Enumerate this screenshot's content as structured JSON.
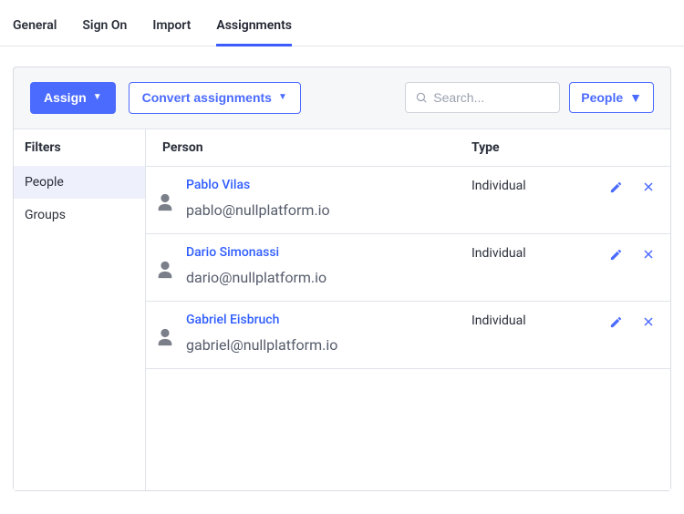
{
  "tabs": [
    {
      "label": "General",
      "active": false
    },
    {
      "label": "Sign On",
      "active": false
    },
    {
      "label": "Import",
      "active": false
    },
    {
      "label": "Assignments",
      "active": true
    }
  ],
  "toolbar": {
    "assign_label": "Assign",
    "convert_label": "Convert assignments",
    "search_placeholder": "Search...",
    "filter_button_label": "People"
  },
  "sidebar": {
    "title": "Filters",
    "items": [
      {
        "label": "People",
        "active": true
      },
      {
        "label": "Groups",
        "active": false
      }
    ]
  },
  "table": {
    "headers": {
      "person": "Person",
      "type": "Type"
    },
    "rows": [
      {
        "name": "Pablo Vilas",
        "email": "pablo@nullplatform.io",
        "type": "Individual"
      },
      {
        "name": "Dario Simonassi",
        "email": "dario@nullplatform.io",
        "type": "Individual"
      },
      {
        "name": "Gabriel Eisbruch",
        "email": "gabriel@nullplatform.io",
        "type": "Individual"
      }
    ]
  }
}
